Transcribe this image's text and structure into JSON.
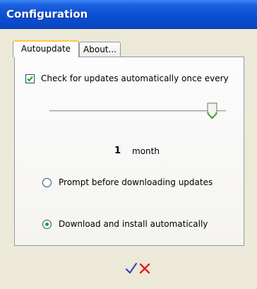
{
  "window": {
    "title": "Configuration"
  },
  "tabs": [
    {
      "label": "Autoupdate",
      "active": true
    },
    {
      "label": "About...",
      "active": false
    }
  ],
  "autoupdate": {
    "check_label": "Check for updates automatically once every",
    "checked": true,
    "slider_level": 0.92,
    "interval_value": "1",
    "interval_unit": "month",
    "options": [
      {
        "label": "Prompt before downloading updates",
        "selected": false
      },
      {
        "label": "Download and install automatically",
        "selected": true
      }
    ]
  },
  "buttons": {
    "ok_icon": "checkmark-icon",
    "cancel_icon": "red-x-icon"
  },
  "colors": {
    "titlebar": "#0c4fd4",
    "tab_highlight": "#ffc83c",
    "check_mark": "#21a121",
    "ok": "#2e3bb8",
    "cancel": "#e02020"
  }
}
